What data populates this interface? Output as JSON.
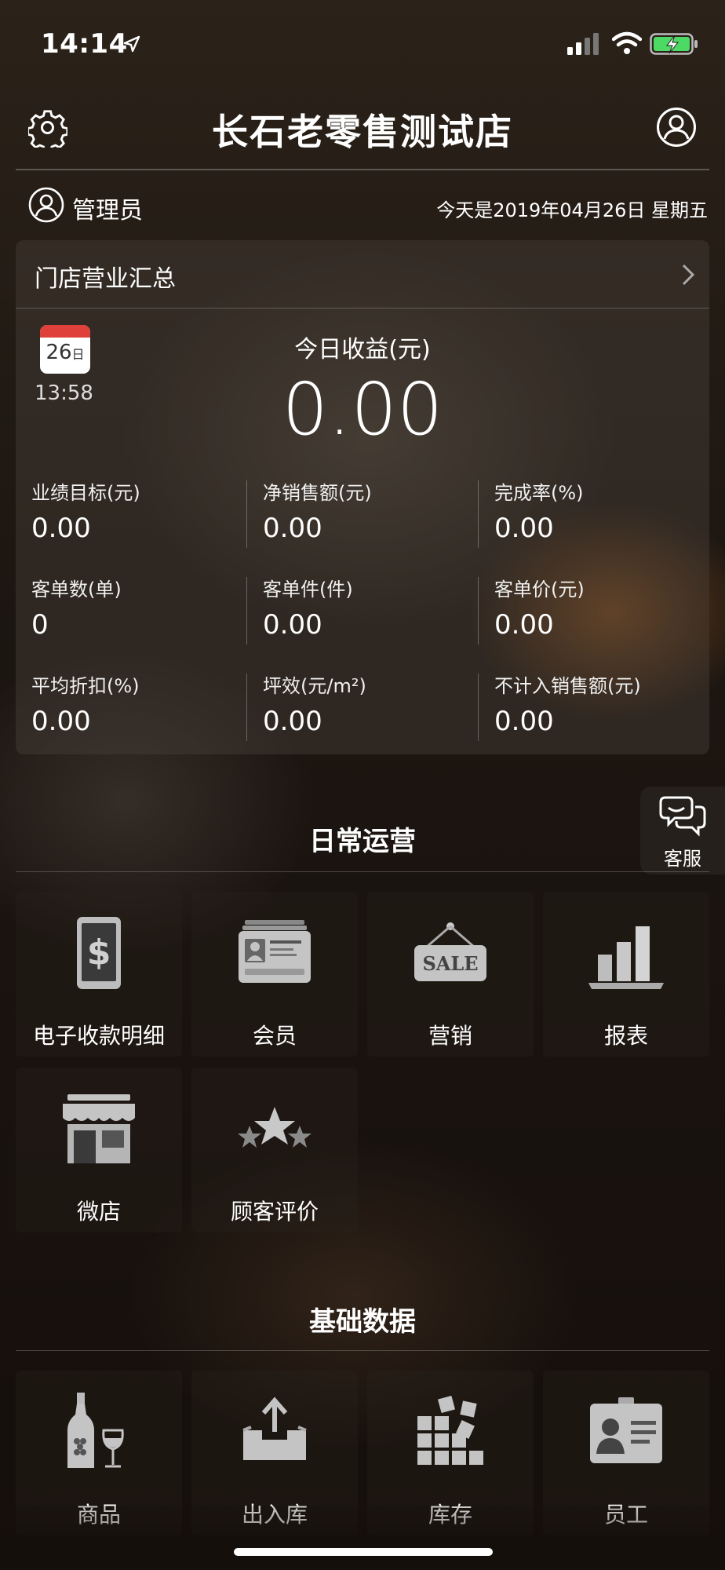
{
  "status_bar": {
    "time": "14:14"
  },
  "header": {
    "title": "长石老零售测试店"
  },
  "user": {
    "name": "管理员",
    "date": "今天是2019年04月26日 星期五"
  },
  "summary": {
    "title": "门店营业汇总",
    "calendar_day": "26",
    "calendar_suffix": "日",
    "time": "13:58",
    "income_label": "今日收益(元)",
    "income_value": "0.00",
    "stats": [
      {
        "label": "业绩目标(元)",
        "value": "0.00"
      },
      {
        "label": "净销售额(元)",
        "value": "0.00"
      },
      {
        "label": "完成率(%)",
        "value": "0.00"
      },
      {
        "label": "客单数(单)",
        "value": "0"
      },
      {
        "label": "客单件(件)",
        "value": "0.00"
      },
      {
        "label": "客单价(元)",
        "value": "0.00"
      },
      {
        "label": "平均折扣(%)",
        "value": "0.00"
      },
      {
        "label": "坪效(元/m²)",
        "value": "0.00"
      },
      {
        "label": "不计入销售额(元)",
        "value": "0.00"
      }
    ]
  },
  "customer_service": {
    "label": "客服"
  },
  "daily_ops": {
    "title": "日常运营",
    "items": [
      {
        "label": "电子收款明细",
        "icon": "payment-tablet-icon"
      },
      {
        "label": "会员",
        "icon": "member-card-icon"
      },
      {
        "label": "营销",
        "icon": "sale-sign-icon"
      },
      {
        "label": "报表",
        "icon": "bar-chart-icon"
      },
      {
        "label": "微店",
        "icon": "storefront-icon"
      },
      {
        "label": "顾客评价",
        "icon": "stars-icon"
      }
    ]
  },
  "basic_data": {
    "title": "基础数据",
    "items": [
      {
        "label": "商品",
        "icon": "wine-icon"
      },
      {
        "label": "出入库",
        "icon": "inbox-icon"
      },
      {
        "label": "库存",
        "icon": "blocks-icon"
      },
      {
        "label": "员工",
        "icon": "employee-badge-icon"
      }
    ]
  },
  "colors": {
    "accent_red": "#e0403a",
    "battery_green": "#4cd964"
  }
}
